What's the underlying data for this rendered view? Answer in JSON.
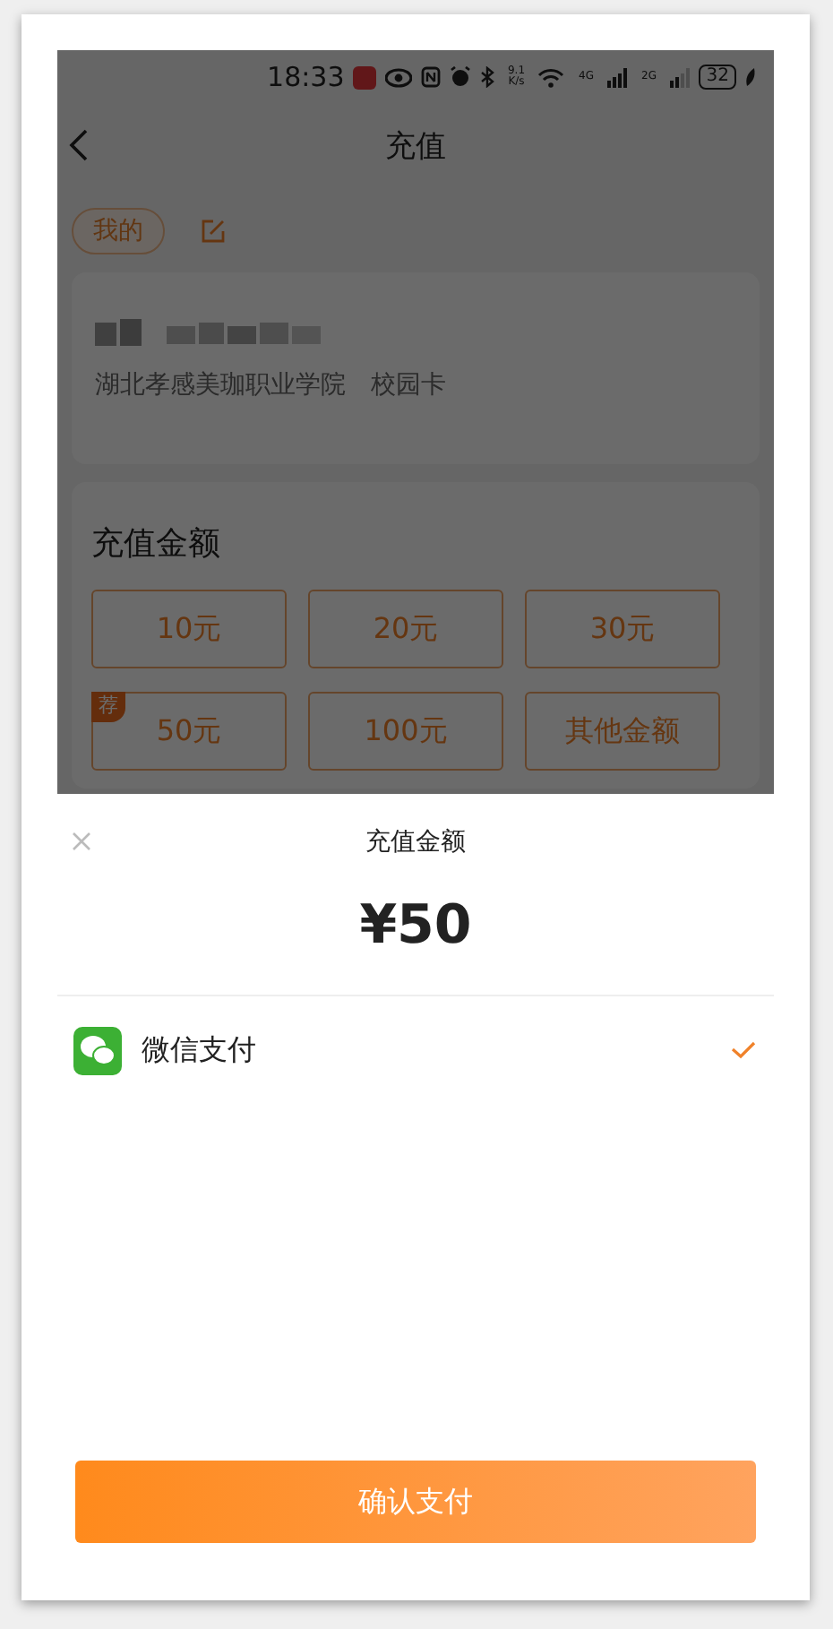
{
  "status_bar": {
    "time": "18:33",
    "network_speed": "9.1 K/s",
    "signal_1": "4G",
    "signal_2": "2G",
    "battery": "32"
  },
  "nav": {
    "title": "充值"
  },
  "account": {
    "tag": "我的",
    "school": "湖北孝感美珈职业学院",
    "card_type": "校园卡"
  },
  "amounts": {
    "title": "充值金额",
    "options": [
      {
        "label": "10元"
      },
      {
        "label": "20元"
      },
      {
        "label": "30元"
      },
      {
        "label": "50元",
        "badge": "荐"
      },
      {
        "label": "100元"
      },
      {
        "label": "其他金额"
      }
    ]
  },
  "sheet": {
    "title": "充值金额",
    "amount": "¥50",
    "methods": [
      {
        "label": "微信支付",
        "selected": true
      }
    ],
    "confirm": "确认支付"
  }
}
